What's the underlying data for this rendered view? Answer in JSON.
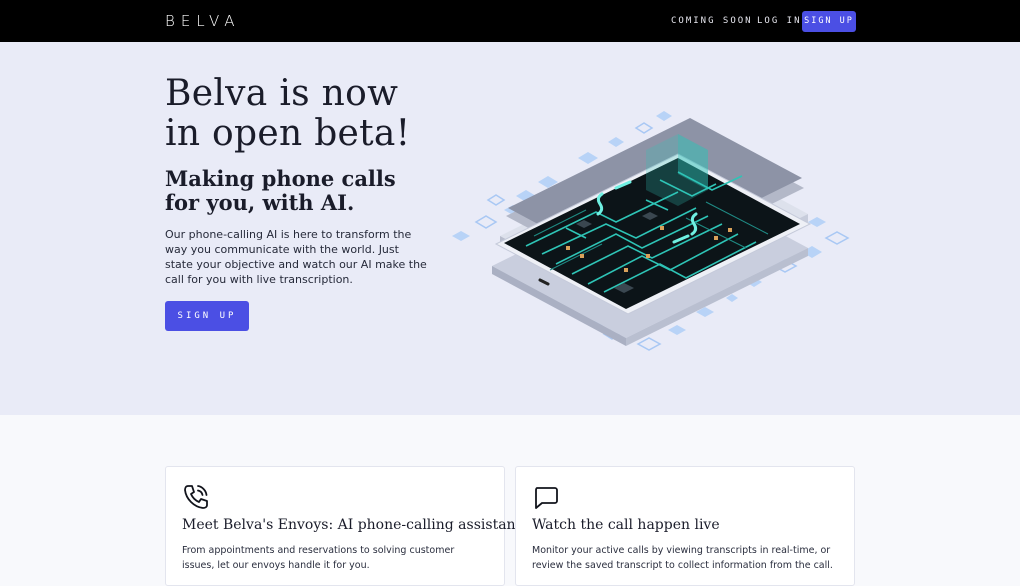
{
  "header": {
    "logo": "BELVA",
    "nav": {
      "coming_soon": "COMING SOON",
      "log_in": "LOG IN",
      "sign_up": "SIGN UP"
    }
  },
  "hero": {
    "title": "Belva is now in open beta!",
    "subtitle": "Making phone calls for you, with AI.",
    "description": "Our phone-calling AI is here to transform the way you communicate with the world. Just state your objective and watch our AI make the call for you with live transcription.",
    "cta": "SIGN UP",
    "illustration": "isometric-tablet-circuit-illustration"
  },
  "features": [
    {
      "icon": "phone-icon",
      "title": "Meet Belva's Envoys: AI phone-calling assistants",
      "text": "From appointments and reservations to solving customer issues, let our envoys handle it for you."
    },
    {
      "icon": "message-square-icon",
      "title": "Watch the call happen live",
      "text": "Monitor your active calls by viewing transcripts in real-time, or review the saved transcript to collect information from the call."
    }
  ],
  "colors": {
    "accent": "#4b4fe4",
    "header_bg": "#000000",
    "hero_bg": "#e9ebf7",
    "page_bg": "#f8f9fc",
    "circuit": "#2ec4b6"
  }
}
